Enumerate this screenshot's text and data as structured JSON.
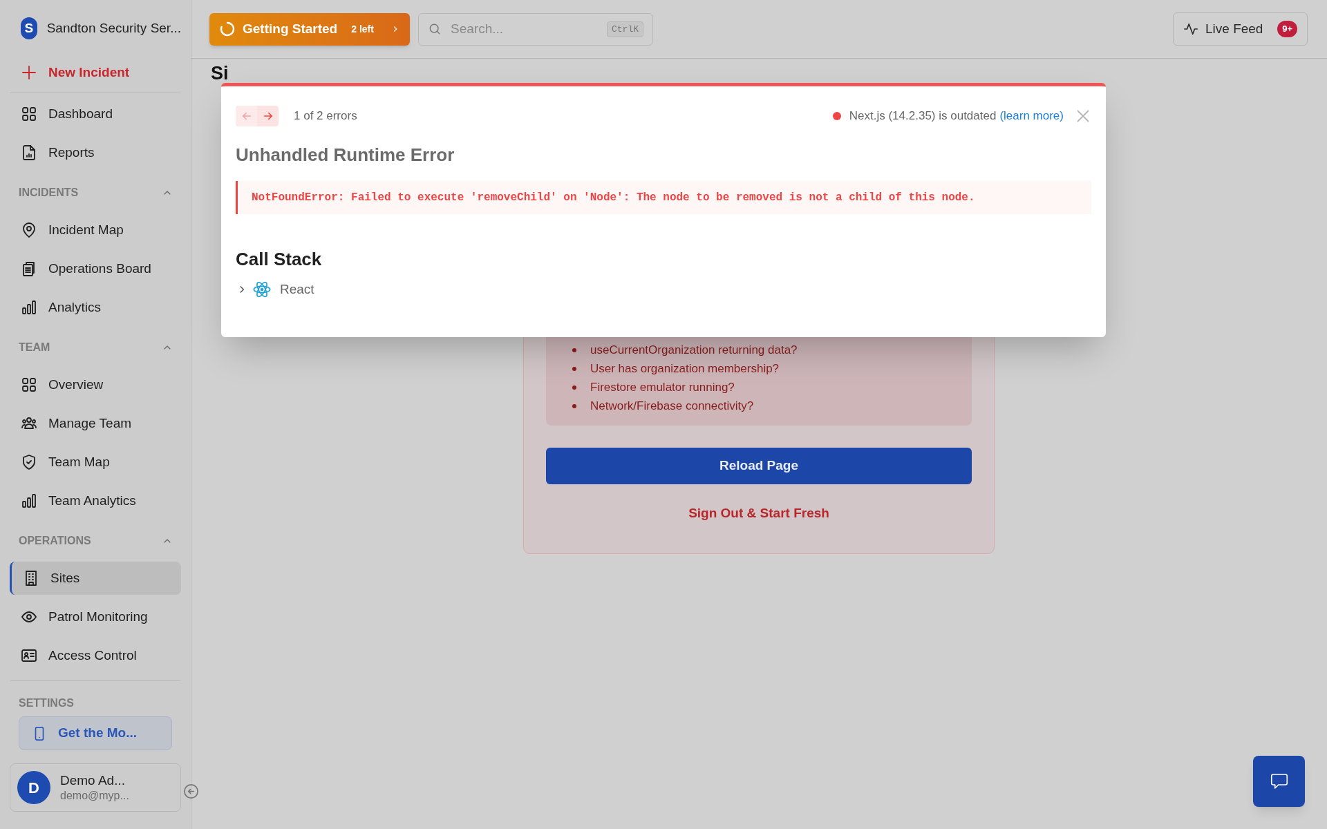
{
  "org": {
    "initial": "S",
    "name": "Sandton Security Ser..."
  },
  "new_incident": "New Incident",
  "nav": [
    {
      "label": "Dashboard",
      "kind": "grid",
      "selected": false
    },
    {
      "label": "Reports",
      "kind": "report",
      "selected": false
    }
  ],
  "sections": [
    {
      "title": "INCIDENTS",
      "expanded": true,
      "items": [
        {
          "label": "Incident Map",
          "kind": "pin",
          "selected": false
        },
        {
          "label": "Operations Board",
          "kind": "clipboard",
          "selected": false
        },
        {
          "label": "Analytics",
          "kind": "bars",
          "selected": false
        }
      ]
    },
    {
      "title": "TEAM",
      "expanded": true,
      "items": [
        {
          "label": "Overview",
          "kind": "grid",
          "selected": false
        },
        {
          "label": "Manage Team",
          "kind": "people",
          "selected": false
        },
        {
          "label": "Team Map",
          "kind": "shield",
          "selected": false
        },
        {
          "label": "Team Analytics",
          "kind": "bars",
          "selected": false
        }
      ]
    },
    {
      "title": "OPERATIONS",
      "expanded": true,
      "items": [
        {
          "label": "Sites",
          "kind": "building",
          "selected": true
        },
        {
          "label": "Patrol Monitoring",
          "kind": "eye",
          "selected": false
        },
        {
          "label": "Access Control",
          "kind": "idcard",
          "selected": false
        }
      ]
    }
  ],
  "settings_title": "SETTINGS",
  "mobile_button": "Get the Mo...",
  "user": {
    "initial": "D",
    "name": "Demo Ad...",
    "email": "demo@myp..."
  },
  "topbar": {
    "getting_started": "Getting Started",
    "remaining": "2 left",
    "search_placeholder": "Search...",
    "shortcut": "CtrlK",
    "live_feed": "Live Feed",
    "live_badge": "9+"
  },
  "page_title": "Si",
  "error_card": {
    "checks": [
      "useCurrentOrganization returning data?",
      "User has organization membership?",
      "Firestore emulator running?",
      "Network/Firebase connectivity?"
    ],
    "reload": "Reload Page",
    "sign_out": "Sign Out & Start Fresh"
  },
  "error_overlay": {
    "counter": "1 of 2 errors",
    "version_notice": "Next.js (14.2.35) is outdated",
    "learn_more": "(learn more)",
    "title": "Unhandled Runtime Error",
    "message": "NotFoundError: Failed to execute 'removeChild' on 'Node': The node to be removed is not a child of this node.",
    "call_stack_title": "Call Stack",
    "frames": [
      {
        "label": "React",
        "expanded": false
      }
    ]
  }
}
